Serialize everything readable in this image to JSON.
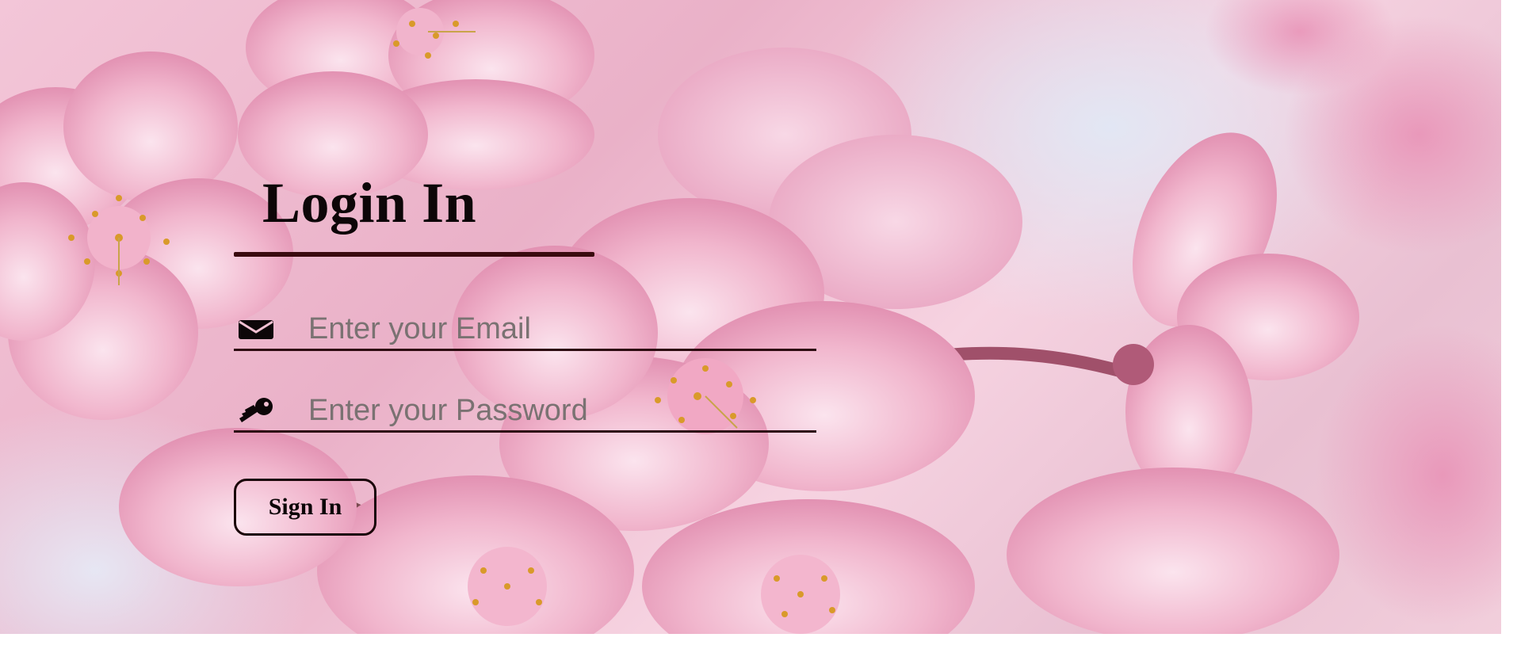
{
  "login": {
    "title": "Login In",
    "email": {
      "placeholder": "Enter your Email",
      "value": "",
      "icon": "envelope-icon"
    },
    "password": {
      "placeholder": "Enter your Password",
      "value": "",
      "icon": "key-icon"
    },
    "submit_label": "Sign In"
  },
  "theme": {
    "accent": "#3a0a0f",
    "background": "cherry-blossom-photo"
  }
}
